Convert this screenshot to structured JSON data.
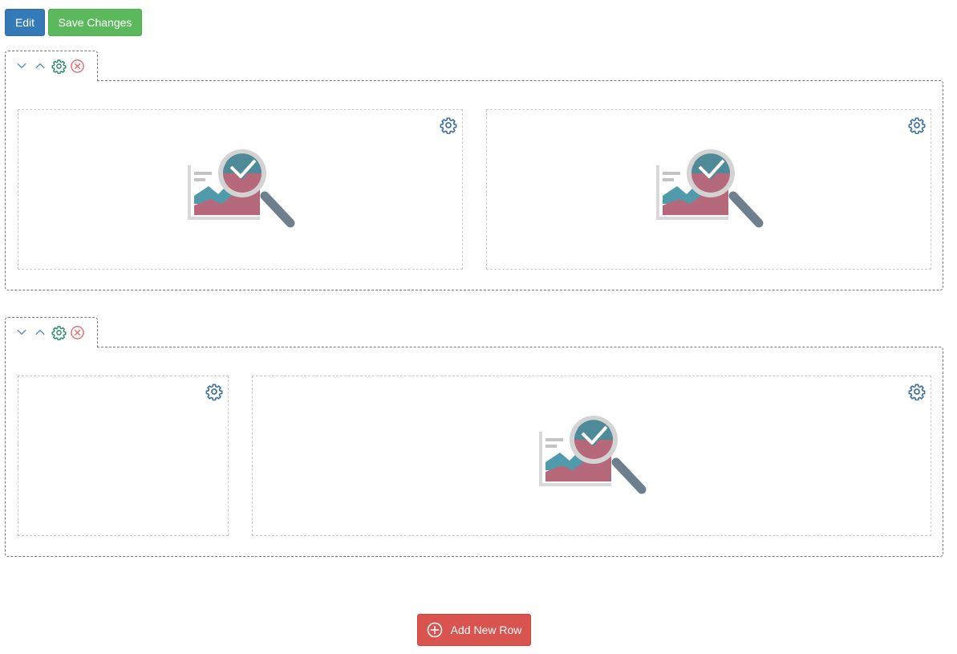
{
  "toolbar": {
    "edit_label": "Edit",
    "save_label": "Save Changes"
  },
  "footer": {
    "add_row_label": "Add New Row",
    "add_row_icon": "plus-circle-icon"
  },
  "colors": {
    "primary": "#337ab7",
    "success": "#5cb85c",
    "danger": "#d9534f",
    "control_blue": "#5b8fc9",
    "control_green": "#2a8a68",
    "control_red": "#e57373"
  },
  "rows": [
    {
      "controls": [
        "chevron-down-icon",
        "chevron-up-icon",
        "gear-icon",
        "close-circle-icon"
      ],
      "columns": [
        {
          "has_placeholder": true,
          "icon": "gear-icon"
        },
        {
          "has_placeholder": true,
          "icon": "gear-icon"
        }
      ]
    },
    {
      "controls": [
        "chevron-down-icon",
        "chevron-up-icon",
        "gear-icon",
        "close-circle-icon"
      ],
      "columns": [
        {
          "has_placeholder": false,
          "icon": "gear-icon"
        },
        {
          "has_placeholder": true,
          "icon": "gear-icon"
        }
      ]
    }
  ]
}
